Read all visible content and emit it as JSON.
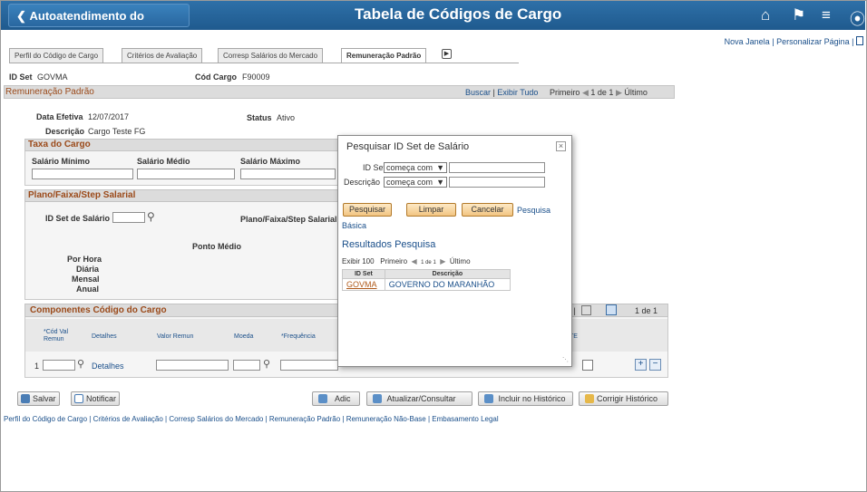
{
  "header": {
    "back_label": "Autoatendimento do Gerente",
    "title": "Tabela de Códigos de Cargo"
  },
  "toplinks": {
    "new_window": "Nova Janela",
    "sep": "|",
    "personalize": "Personalizar Página",
    "sep2": "|"
  },
  "tabs": [
    {
      "label": "Perfil do Código de Cargo"
    },
    {
      "label": "Critérios de Avaliação"
    },
    {
      "label": "Corresp Salários do Mercado"
    },
    {
      "label": "Remuneração Padrão"
    }
  ],
  "ids": {
    "setid_label": "ID Set",
    "setid_value": "GOVMA",
    "jobcode_label": "Cód Cargo",
    "jobcode_value": "F90009"
  },
  "remuneracao": {
    "title": "Remuneração Padrão",
    "nav_search": "Buscar",
    "nav_sep": "|",
    "nav_view_all": "Exibir Tudo",
    "nav_first": "Primeiro",
    "nav_count": "1 de 1",
    "nav_last": "Último",
    "eff_date_label": "Data Efetiva",
    "eff_date_value": "12/07/2017",
    "status_label": "Status",
    "status_value": "Ativo",
    "desc_label": "Descrição",
    "desc_value": "Cargo Teste FG"
  },
  "taxa": {
    "title": "Taxa do Cargo",
    "min_label": "Salário Mínimo",
    "mid_label": "Salário Médio",
    "max_label": "Salário Máximo"
  },
  "plano": {
    "title": "Plano/Faixa/Step Salarial",
    "setid_label": "ID Set de Salário",
    "plan_label": "Plano/Faixa/Step Salarial",
    "midpoint_label": "Ponto Médio",
    "hourly": "Por Hora",
    "daily": "Diária",
    "monthly": "Mensal",
    "annual": "Anual"
  },
  "componentes": {
    "title": "Componentes Código do Cargo",
    "nav_text": "r |",
    "count": "1 de 1",
    "col1": "*Cód Val Remun",
    "col2": "Detalhes",
    "col3": "Valor Remun",
    "col4": "Moeda",
    "col5": "*Frequência",
    "col_te": "TE",
    "row_num": "1",
    "row_details": "Detalhes"
  },
  "buttons": {
    "save": "Salvar",
    "notify": "Notificar",
    "add": "Adic",
    "update": "Atualizar/Consultar",
    "include_history": "Incluir no Histórico",
    "correct_history": "Corrigir Histórico"
  },
  "footer_links": "Perfil do Código de Cargo | Critérios de Avaliação | Corresp Salários do Mercado | Remuneração Padrão | Remuneração Não-Base | Embasamento Legal",
  "modal": {
    "title": "Pesquisar ID Set de Salário",
    "close": "×",
    "setid_label": "ID Set",
    "setid_op": "começa com",
    "desc_label": "Descrição",
    "desc_op": "começa com",
    "btn_search": "Pesquisar",
    "btn_clear": "Limpar",
    "btn_cancel": "Cancelar",
    "basic_search_a": "Pesquisa",
    "basic_search_b": "Básica",
    "results_title": "Resultados Pesquisa",
    "show": "Exibir 100",
    "first": "Primeiro",
    "count": "1 de 1",
    "last": "Último",
    "col_setid": "ID Set",
    "col_desc": "Descrição",
    "rows": [
      {
        "setid": "GOVMA",
        "desc": "GOVERNO DO MARANHÃO"
      }
    ]
  },
  "colors": {
    "header_bg": "#1f5a8e",
    "section_title": "#9b4a1a",
    "link": "#1a4f8a",
    "modal_button": "#f2c582"
  }
}
